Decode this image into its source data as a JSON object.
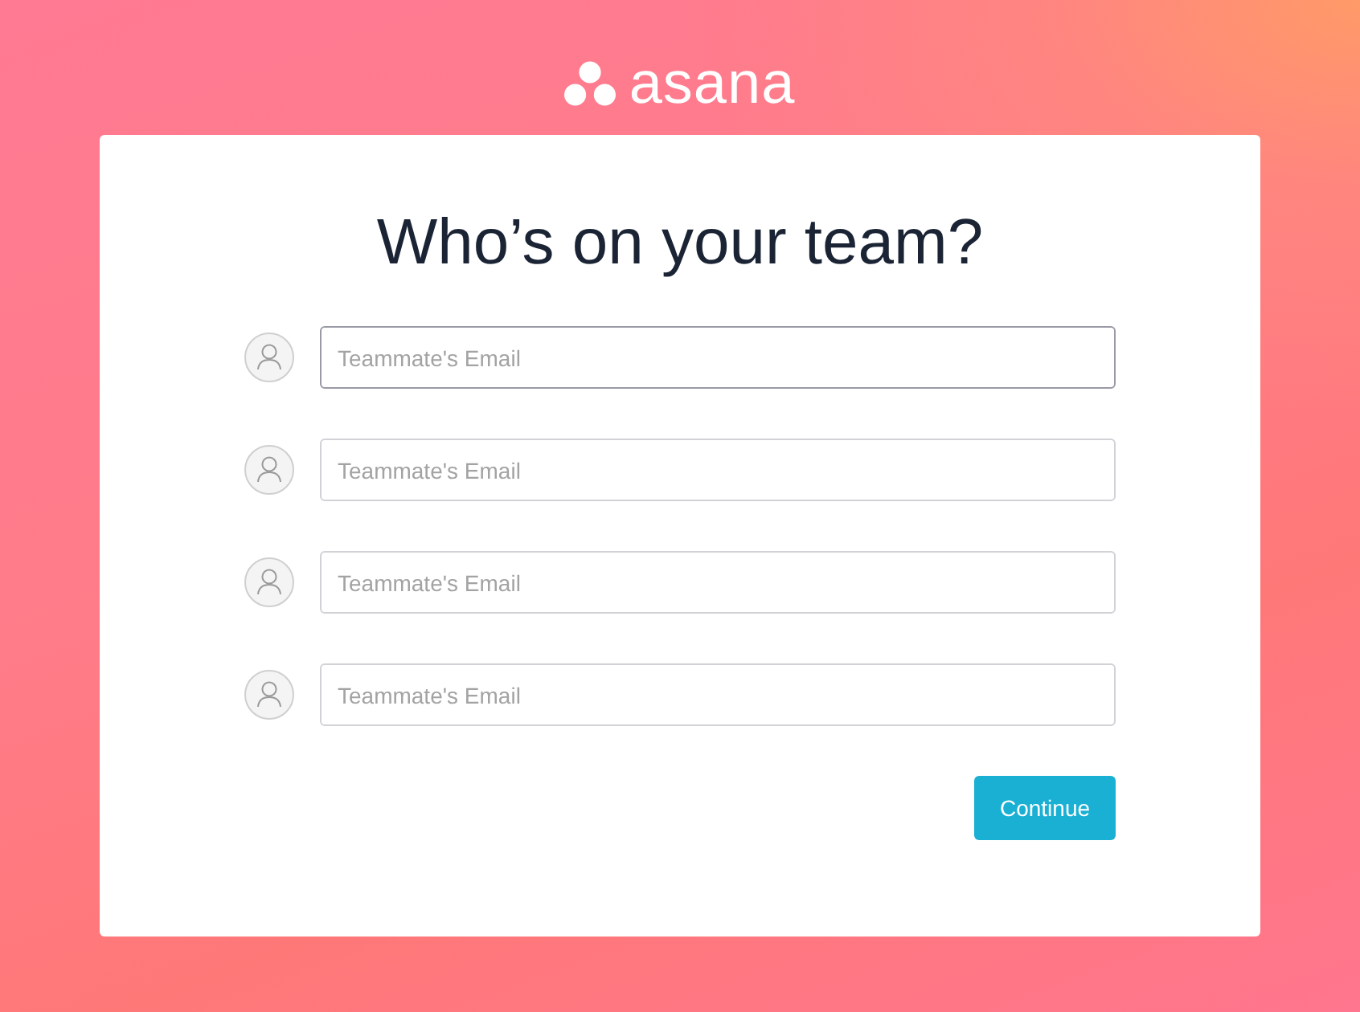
{
  "logo": {
    "text": "asana"
  },
  "card": {
    "title": "Who’s on your team?",
    "invites": [
      {
        "placeholder": "Teammate's Email",
        "focused": true
      },
      {
        "placeholder": "Teammate's Email",
        "focused": false
      },
      {
        "placeholder": "Teammate's Email",
        "focused": false
      },
      {
        "placeholder": "Teammate's Email",
        "focused": false
      }
    ],
    "continue_button": "Continue"
  }
}
